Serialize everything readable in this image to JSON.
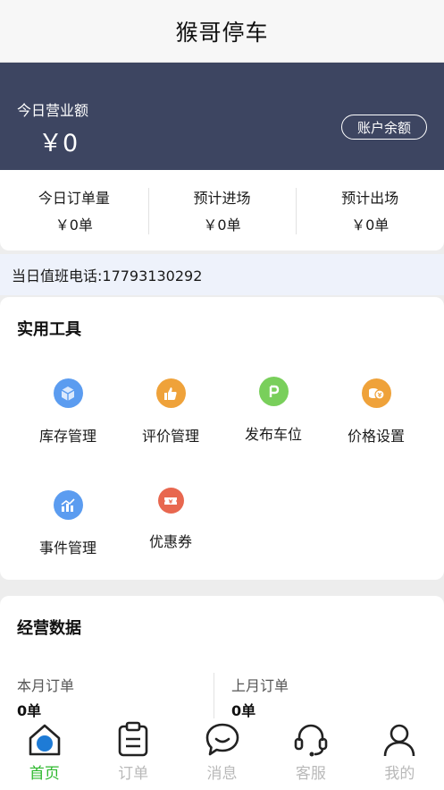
{
  "header": {
    "title": "猴哥停车"
  },
  "revenue": {
    "label": "今日营业额",
    "amount": "￥0",
    "balance_button": "账户余额"
  },
  "stats": [
    {
      "label": "今日订单量",
      "value": "￥0单"
    },
    {
      "label": "预计进场",
      "value": "￥0单"
    },
    {
      "label": "预计出场",
      "value": "￥0单"
    }
  ],
  "duty_phone": "当日值班电话:17793130292",
  "tools": {
    "title": "实用工具",
    "items": [
      {
        "label": "库存管理",
        "icon": "cube-icon",
        "color": "#5b9cf0"
      },
      {
        "label": "评价管理",
        "icon": "thumbs-up-icon",
        "color": "#efa23a"
      },
      {
        "label": "发布车位",
        "icon": "parking-icon",
        "color": "#79cf5b"
      },
      {
        "label": "价格设置",
        "icon": "coins-icon",
        "color": "#efa23a"
      },
      {
        "label": "事件管理",
        "icon": "chart-icon",
        "color": "#5b9cf0"
      },
      {
        "label": "优惠券",
        "icon": "coupon-icon",
        "color": "#e8674f"
      }
    ]
  },
  "business": {
    "title": "经营数据",
    "this_month_label": "本月订单",
    "this_month_value": "0单",
    "last_month_label": "上月订单",
    "last_month_value": "0单"
  },
  "tabbar": {
    "active_color": "#2eb82e",
    "items": [
      {
        "label": "首页",
        "icon": "home-icon"
      },
      {
        "label": "订单",
        "icon": "clipboard-icon"
      },
      {
        "label": "消息",
        "icon": "chat-icon"
      },
      {
        "label": "客服",
        "icon": "headset-icon"
      },
      {
        "label": "我的",
        "icon": "user-icon"
      }
    ]
  }
}
